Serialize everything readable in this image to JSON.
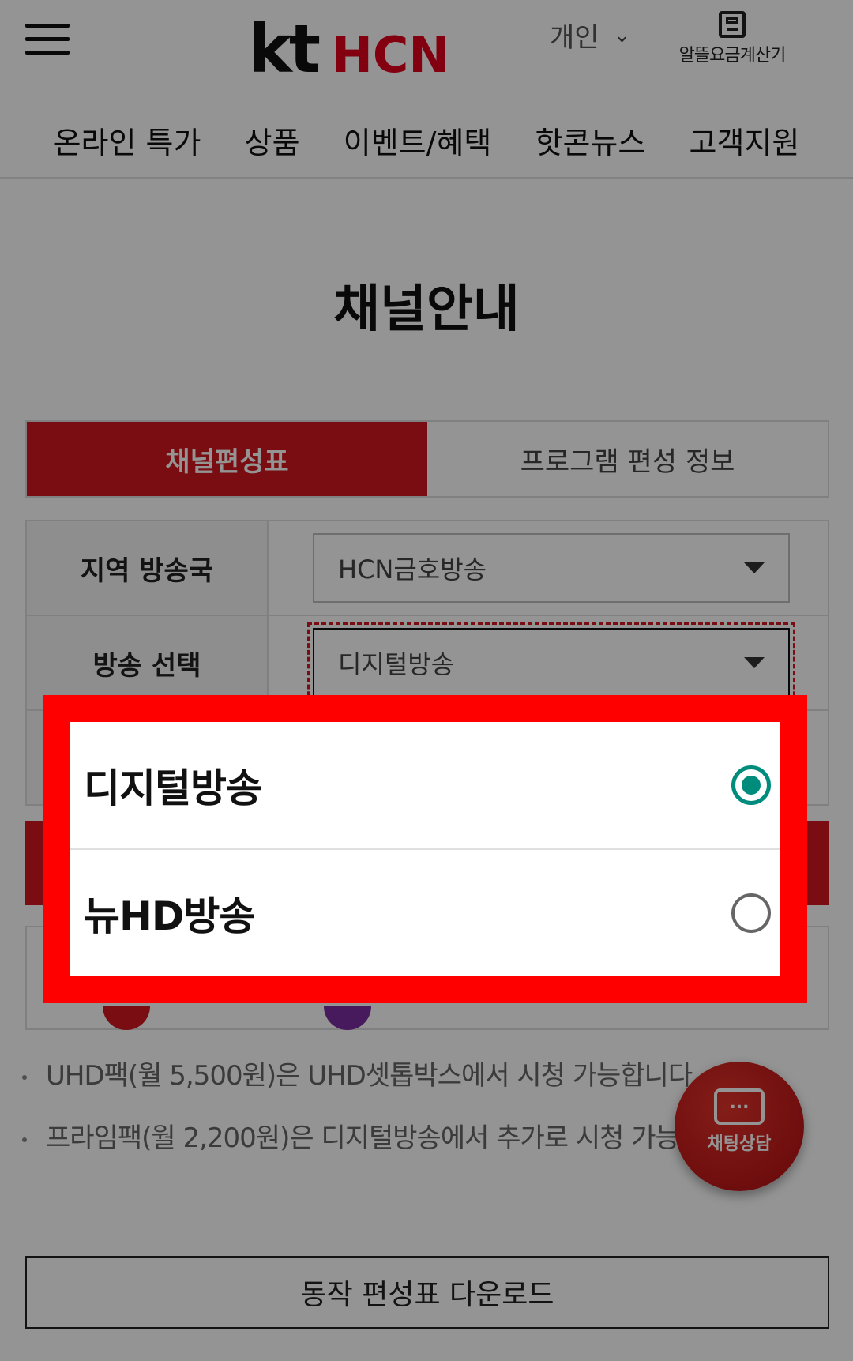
{
  "header": {
    "logo_kt": "kt",
    "logo_hcn": "HCN",
    "segment_label": "개인",
    "calculator_label": "알뜰요금계산기"
  },
  "nav": {
    "items": [
      "온라인 특가",
      "상품",
      "이벤트/혜택",
      "핫콘뉴스",
      "고객지원"
    ]
  },
  "page": {
    "title": "채널안내"
  },
  "tabs": [
    {
      "label": "채널편성표",
      "active": true
    },
    {
      "label": "프로그램 편성 정보",
      "active": false
    }
  ],
  "form": {
    "region_label": "지역 방송국",
    "region_value": "HCN금호방송",
    "broadcast_label": "방송 선택",
    "broadcast_value": "디지털방송"
  },
  "notes": [
    "UHD팩(월 5,500원)은 UHD셋톱박스에서 시청 가능합니다",
    "프라임팩(월 2,200원)은 디지털방송에서 추가로 시청 가능"
  ],
  "download_button": "동작 편성표 다운로드",
  "chat_button": {
    "bubble_text": "...",
    "label": "채팅상담"
  },
  "dialog": {
    "options": [
      {
        "label": "디지털방송",
        "selected": true
      },
      {
        "label": "뉴HD방송",
        "selected": false
      }
    ],
    "frame_color": "#ff0000",
    "radio_color": "#008c7c"
  },
  "colors": {
    "brand_red": "#d0171f",
    "logo_red": "#e1001c"
  }
}
